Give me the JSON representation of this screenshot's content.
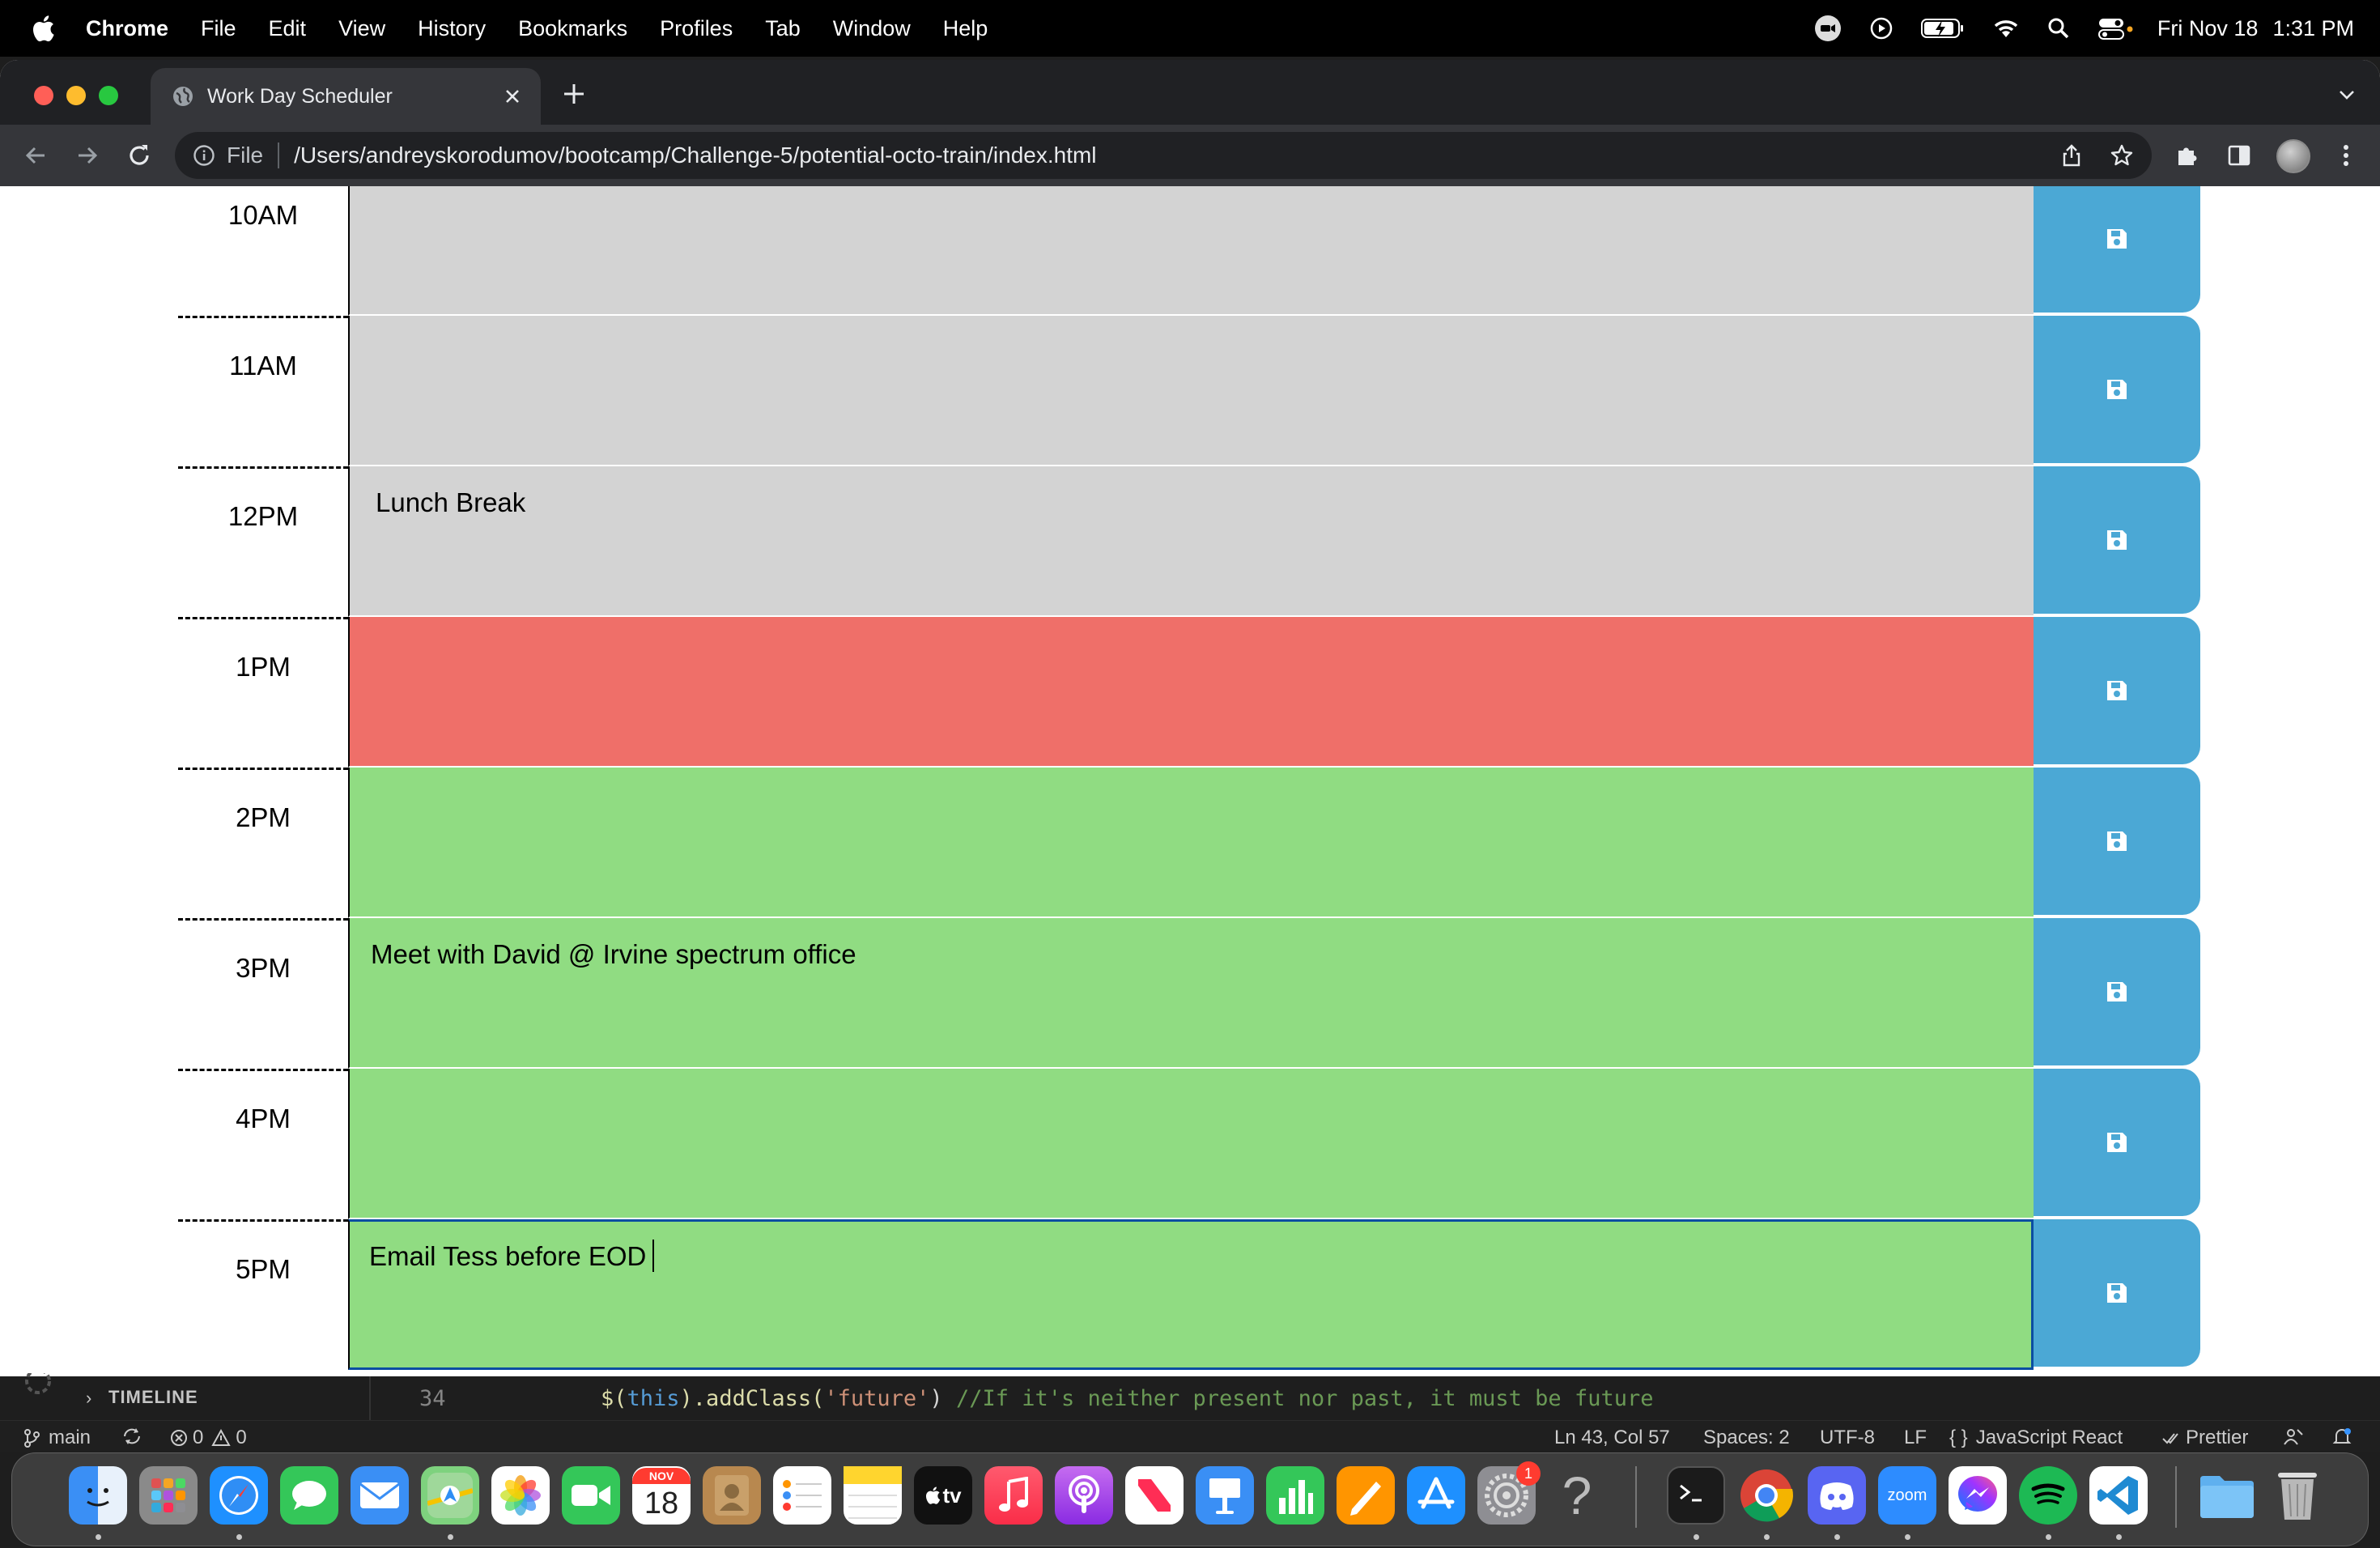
{
  "menubar": {
    "app_name": "Chrome",
    "menus": [
      "File",
      "Edit",
      "View",
      "History",
      "Bookmarks",
      "Profiles",
      "Tab",
      "Window",
      "Help"
    ],
    "date": "Fri Nov 18",
    "time": "1:31 PM",
    "status_icons": [
      "zoom-icon",
      "screen-record-icon",
      "battery-charging-icon",
      "wifi-icon",
      "spotlight-search-icon",
      "control-center-icon"
    ]
  },
  "browser": {
    "tab_title": "Work Day Scheduler",
    "url_scheme": "File",
    "url": "/Users/andreyskorodumov/bootcamp/Challenge-5/potential-octo-train/index.html"
  },
  "scheduler": {
    "rows": [
      {
        "hour": "10AM",
        "state": "past",
        "text": ""
      },
      {
        "hour": "11AM",
        "state": "past",
        "text": ""
      },
      {
        "hour": "12PM",
        "state": "past",
        "text": "Lunch Break"
      },
      {
        "hour": "1PM",
        "state": "present",
        "text": ""
      },
      {
        "hour": "2PM",
        "state": "future",
        "text": ""
      },
      {
        "hour": "3PM",
        "state": "future",
        "text": "Meet with David @ Irvine spectrum office"
      },
      {
        "hour": "4PM",
        "state": "future",
        "text": ""
      },
      {
        "hour": "5PM",
        "state": "future",
        "text": "Email Tess before EOD"
      }
    ],
    "colors": {
      "past": "#d3d3d3",
      "present": "#ef6f69",
      "future": "#90dc82",
      "save": "#4ba8d5"
    }
  },
  "vscode": {
    "panel_label": "TIMELINE",
    "line_number": "34",
    "code": {
      "func": "$(",
      "this": "this",
      "mid": ").addClass(",
      "str": "'future'",
      "close": ")",
      "comment": "//If it's neither present nor past, it must be future"
    },
    "status": {
      "branch": "main",
      "errors": "0",
      "warnings": "0",
      "position": "Ln 43, Col 57",
      "spaces": "Spaces: 2",
      "encoding": "UTF-8",
      "eol": "LF",
      "language": "JavaScript React",
      "formatter": "Prettier"
    }
  },
  "dock": {
    "calendar_month": "NOV",
    "calendar_day": "18",
    "settings_badge": "1",
    "tv_label": "tv",
    "zoom_label": "zoom",
    "help_glyph": "?"
  }
}
